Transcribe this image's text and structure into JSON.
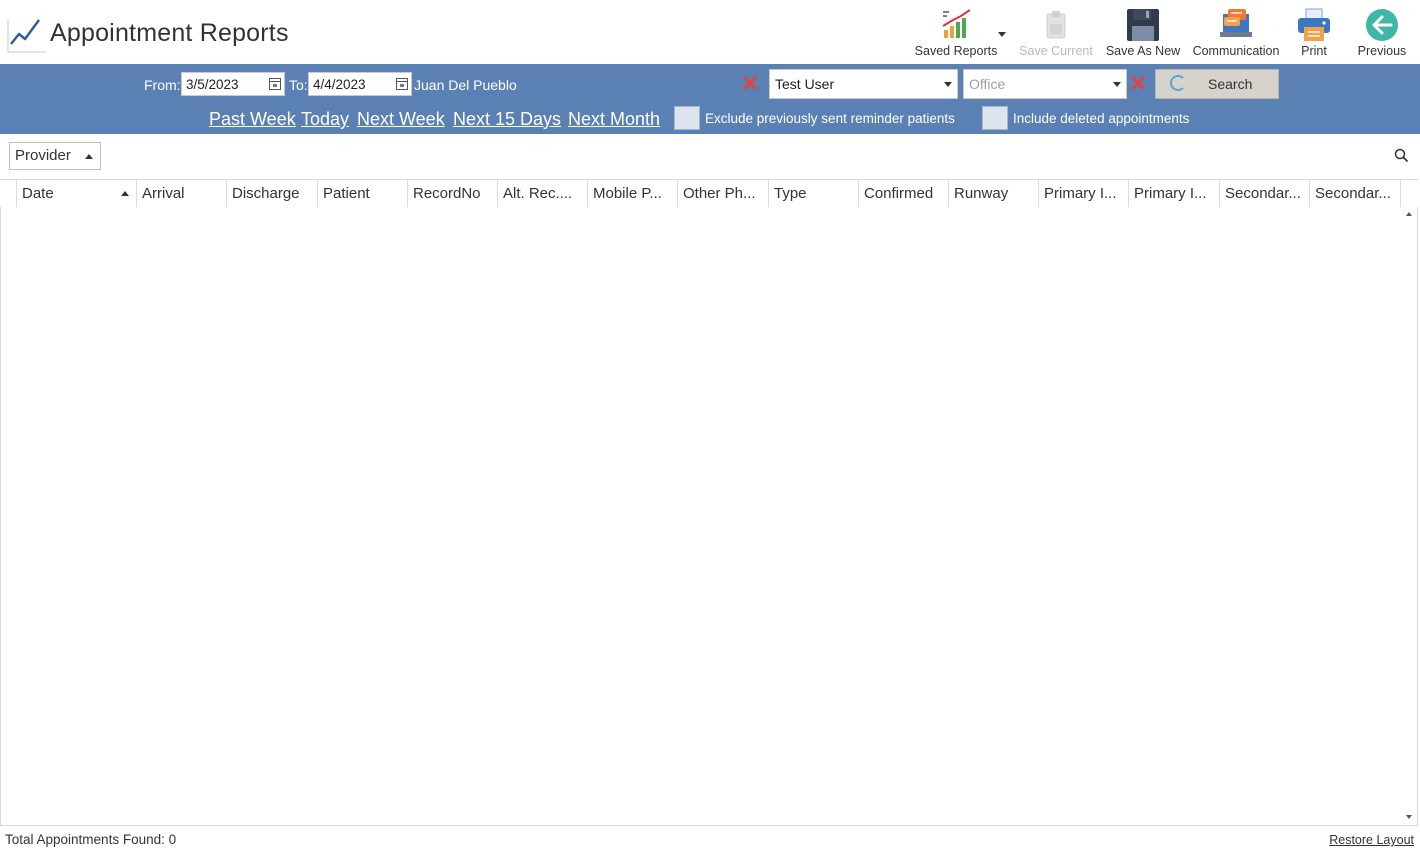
{
  "header": {
    "title": "Appointment Reports",
    "toolbar": [
      {
        "name": "saved-reports",
        "label": "Saved Reports",
        "icon": "bar-chart-icon"
      },
      {
        "name": "save-current",
        "label": "Save Current",
        "icon": "clipboard-icon",
        "disabled": true
      },
      {
        "name": "save-as-new",
        "label": "Save As New",
        "icon": "floppy-disk-icon"
      },
      {
        "name": "communication",
        "label": "Communication",
        "icon": "laptop-chat-icon"
      },
      {
        "name": "print",
        "label": "Print",
        "icon": "printer-icon"
      },
      {
        "name": "previous",
        "label": "Previous",
        "icon": "back-arrow-icon"
      }
    ]
  },
  "filters": {
    "from_label": "From:",
    "from_value": "3/5/2023",
    "to_label": "To:",
    "to_value": "4/4/2023",
    "provider_name": "Juan Del Pueblo",
    "user_select": "Test User",
    "office_placeholder": "Office",
    "search_label": "Search",
    "quick_links": [
      "Past Week",
      "Today",
      "Next Week",
      "Next 15 Days",
      "Next Month"
    ],
    "exclude_reminder_label": "Exclude previously sent reminder patients",
    "include_deleted_label": "Include deleted appointments"
  },
  "group_by": {
    "label": "Provider"
  },
  "grid": {
    "columns": [
      "Date",
      "Arrival",
      "Discharge",
      "Patient",
      "RecordNo",
      "Alt. Rec....",
      "Mobile P...",
      "Other Ph...",
      "Type",
      "Confirmed",
      "Runway",
      "Primary I...",
      "Primary I...",
      "Secondar...",
      "Secondar..."
    ]
  },
  "footer": {
    "total": "Total Appointments Found: 0",
    "restore_layout": "Restore Layout"
  },
  "colors": {
    "filter_band": "#5b80b4",
    "search_button": "#d6d3cc",
    "clear_x": "#e84040"
  }
}
